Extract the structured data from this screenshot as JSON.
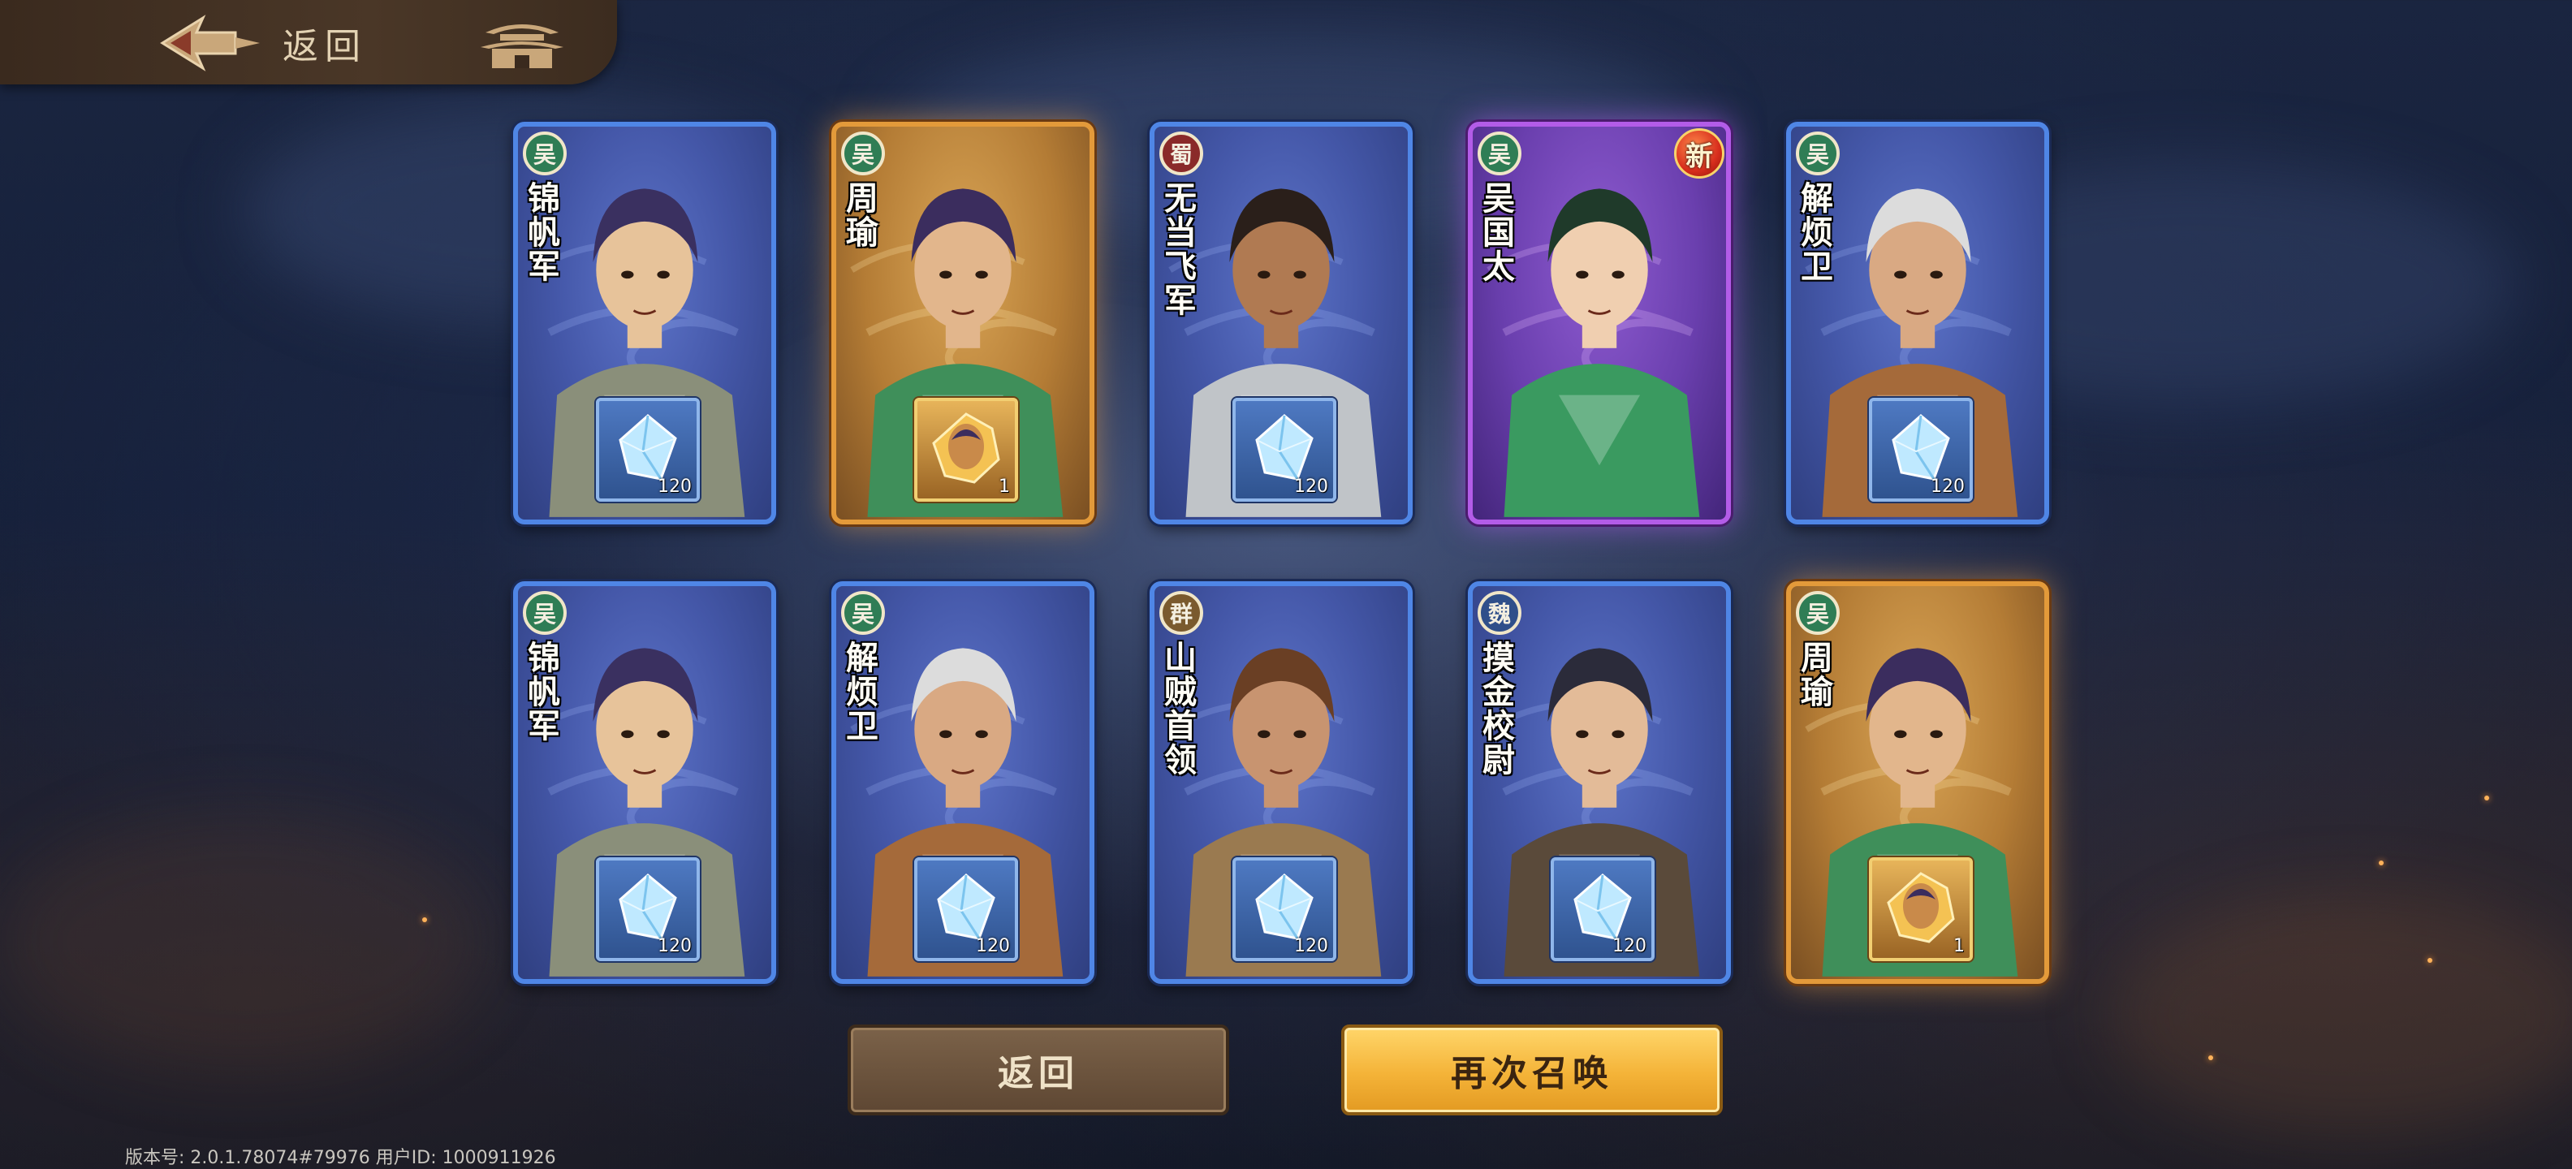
{
  "topbar": {
    "back_label": "返回"
  },
  "cards": [
    {
      "faction": "吴",
      "faction_color": "#2f7d55",
      "name": "锦帆军",
      "rarity": "blue",
      "reward": "crystal",
      "count": "120",
      "is_new": false
    },
    {
      "faction": "吴",
      "faction_color": "#2f7d55",
      "name": "周瑜",
      "rarity": "gold",
      "reward": "hero-shard",
      "count": "1",
      "is_new": false
    },
    {
      "faction": "蜀",
      "faction_color": "#8a2a2a",
      "name": "无当飞军",
      "rarity": "blue",
      "reward": "crystal",
      "count": "120",
      "is_new": false
    },
    {
      "faction": "吴",
      "faction_color": "#2f7d55",
      "name": "吴国太",
      "rarity": "purple",
      "reward": "none",
      "count": "",
      "is_new": true,
      "new_label": "新"
    },
    {
      "faction": "吴",
      "faction_color": "#2f7d55",
      "name": "解烦卫",
      "rarity": "blue",
      "reward": "crystal",
      "count": "120",
      "is_new": false
    },
    {
      "faction": "吴",
      "faction_color": "#2f7d55",
      "name": "锦帆军",
      "rarity": "blue",
      "reward": "crystal",
      "count": "120",
      "is_new": false
    },
    {
      "faction": "吴",
      "faction_color": "#2f7d55",
      "name": "解烦卫",
      "rarity": "blue",
      "reward": "crystal",
      "count": "120",
      "is_new": false
    },
    {
      "faction": "群",
      "faction_color": "#7a5a2e",
      "name": "山贼首领",
      "rarity": "blue",
      "reward": "crystal",
      "count": "120",
      "is_new": false
    },
    {
      "faction": "魏",
      "faction_color": "#2f4f8a",
      "name": "摸金校尉",
      "rarity": "blue",
      "reward": "crystal",
      "count": "120",
      "is_new": false
    },
    {
      "faction": "吴",
      "faction_color": "#2f7d55",
      "name": "周瑜",
      "rarity": "gold",
      "reward": "hero-shard",
      "count": "1",
      "is_new": false
    }
  ],
  "buttons": {
    "back_label": "返回",
    "summon_again_label": "再次召唤"
  },
  "footer": {
    "version_text": "版本号: 2.0.1.78074#79976 用户ID: 1000911926"
  },
  "colors": {
    "card_blue_border": "#4f86e6",
    "card_gold_border": "#e39a3a",
    "card_purple_border": "#b35ce8",
    "summon_button": "#f4b338",
    "back_button": "#6e563f"
  }
}
